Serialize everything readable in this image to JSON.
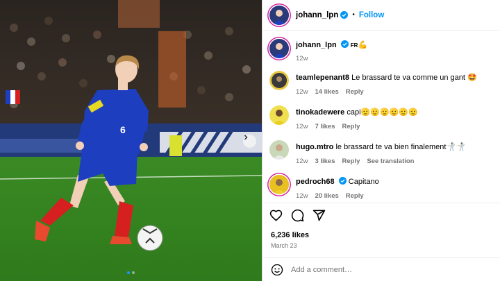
{
  "post": {
    "author": "johann_lpn",
    "follow_label": "Follow",
    "separator": "•",
    "caption_flag": "FR",
    "caption_time": "12w"
  },
  "comments": [
    {
      "user": "teamlepenant8",
      "text": "Le brassard te va comme un gant 🤩",
      "time": "12w",
      "likes": "14 likes",
      "reply": "Reply"
    },
    {
      "user": "tinokadewere",
      "text": "capi🫡🫡🫡🫡🫡🫡",
      "time": "12w",
      "likes": "7 likes",
      "reply": "Reply"
    },
    {
      "user": "hugo.mtro",
      "text": "le brassard te va bien finalement🤺🤺",
      "time": "12w",
      "likes": "3 likes",
      "reply": "Reply",
      "translate": "See translation"
    },
    {
      "user": "pedroch68",
      "text": "Capitano",
      "time": "12w",
      "likes": "20 likes",
      "reply": "Reply"
    }
  ],
  "stats": {
    "likes": "6,236 likes",
    "date": "March 23"
  },
  "add_comment": {
    "placeholder": "Add a comment…"
  },
  "photo": {
    "jersey_number": "6"
  },
  "colors": {
    "accent": "#0095f6",
    "ring": "#d6249f",
    "verified": "#0095f6",
    "jersey": "#1d3fbf",
    "socks": "#d62020"
  }
}
